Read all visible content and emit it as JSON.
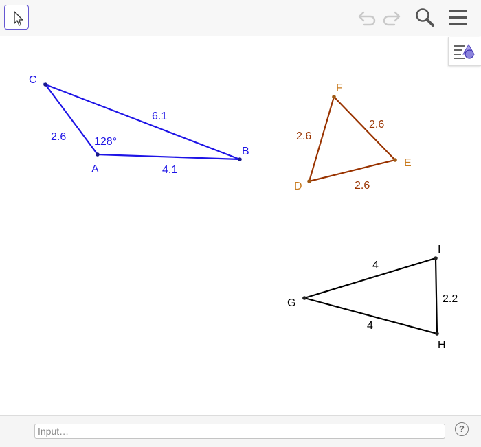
{
  "toolbar": {
    "active_tool_icon": "move-arrow-icon",
    "icons": [
      "undo-icon",
      "redo-icon",
      "search-icon",
      "menu-icon"
    ]
  },
  "style_bar": {
    "icon": "style-bar-toggle-icon"
  },
  "figures": {
    "triangle_abc": {
      "color": "#1e14e6",
      "vertices": {
        "A": "A",
        "B": "B",
        "C": "C"
      },
      "sides": {
        "AB": "4.1",
        "AC": "2.6",
        "BC": "6.1"
      },
      "angle_A": "128°"
    },
    "triangle_def": {
      "color": "#993300",
      "vertices": {
        "D": "D",
        "E": "E",
        "F": "F"
      },
      "sides": {
        "DF": "2.6",
        "FE": "2.6",
        "DE": "2.6"
      }
    },
    "triangle_ghi": {
      "color": "#000000",
      "vertices": {
        "G": "G",
        "H": "H",
        "I": "I"
      },
      "sides": {
        "GI": "4",
        "GH": "4",
        "HI": "2.2"
      }
    }
  },
  "input_bar": {
    "placeholder": "Input…"
  },
  "help": {
    "icon": "help-icon",
    "glyph": "?"
  }
}
